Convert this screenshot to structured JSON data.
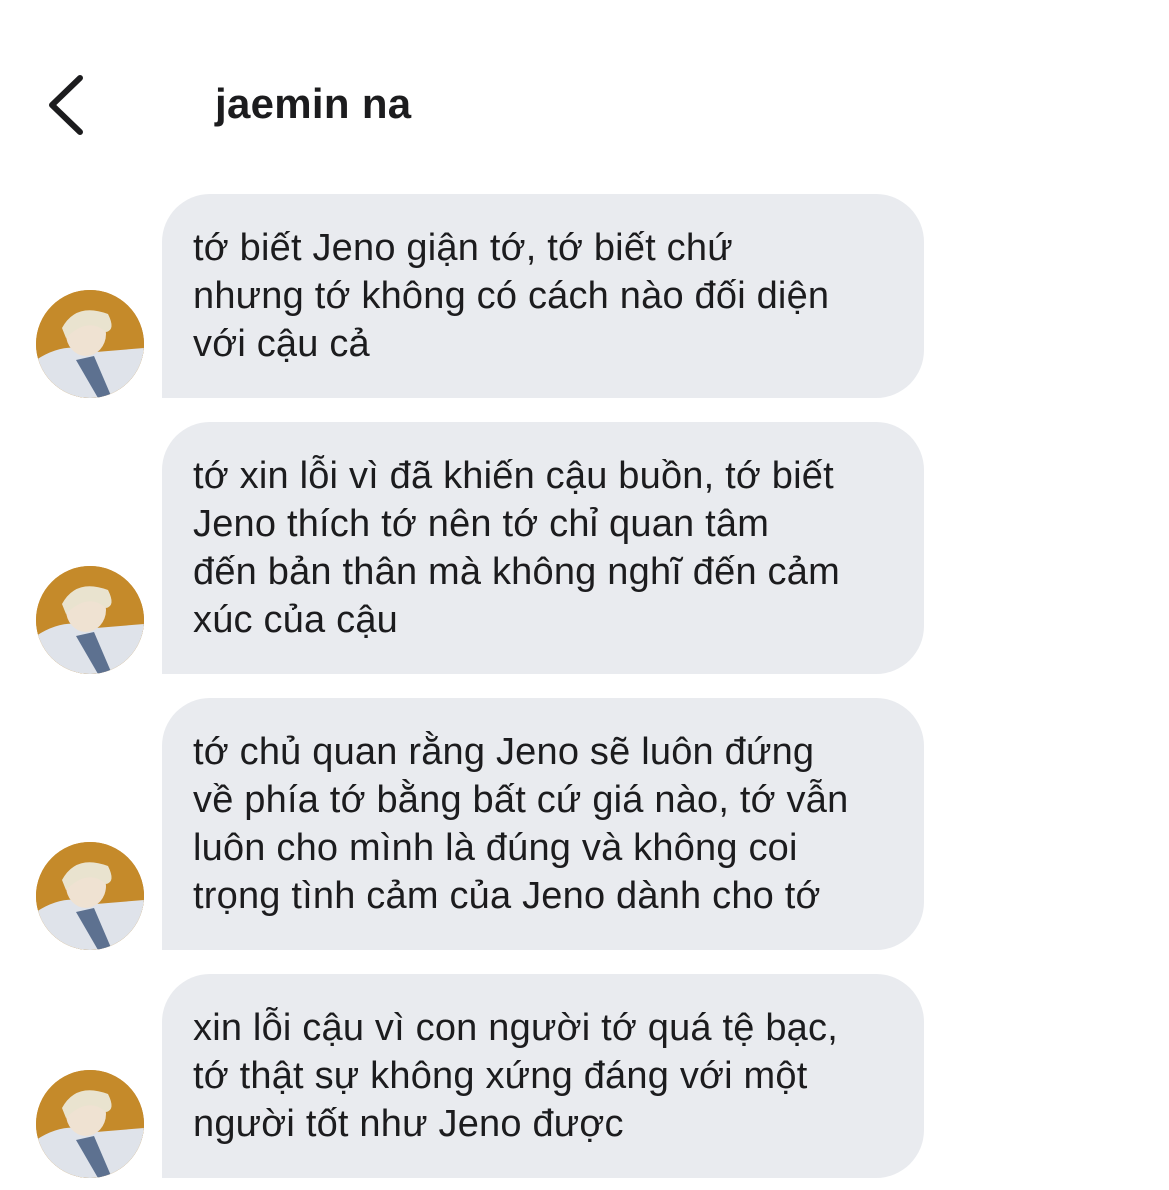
{
  "header": {
    "title": "jaemin na"
  },
  "messages": [
    {
      "text": "tớ biết Jeno giận tớ, tớ biết chứ\nnhưng tớ không có cách nào đối diện\nvới cậu cả"
    },
    {
      "text": "tớ xin lỗi vì đã khiến cậu buồn, tớ biết\nJeno thích tớ nên tớ chỉ quan tâm\nđến bản thân mà không nghĩ đến cảm\nxúc của cậu"
    },
    {
      "text": "tớ chủ quan rằng Jeno sẽ luôn đứng\nvề phía tớ bằng bất cứ giá nào, tớ vẫn\nluôn cho mình là đúng và không coi\ntrọng tình cảm của Jeno dành cho tớ"
    },
    {
      "text": "xin lỗi cậu vì con người tớ quá tệ bạc,\ntớ thật sự không xứng đáng với một\nngười tốt như Jeno được"
    }
  ],
  "colors": {
    "bubble": "#e9ebef",
    "text": "#1c1c1e",
    "background": "#ffffff"
  },
  "icons": {
    "back": "chevron-left-icon",
    "avatar": "avatar"
  }
}
